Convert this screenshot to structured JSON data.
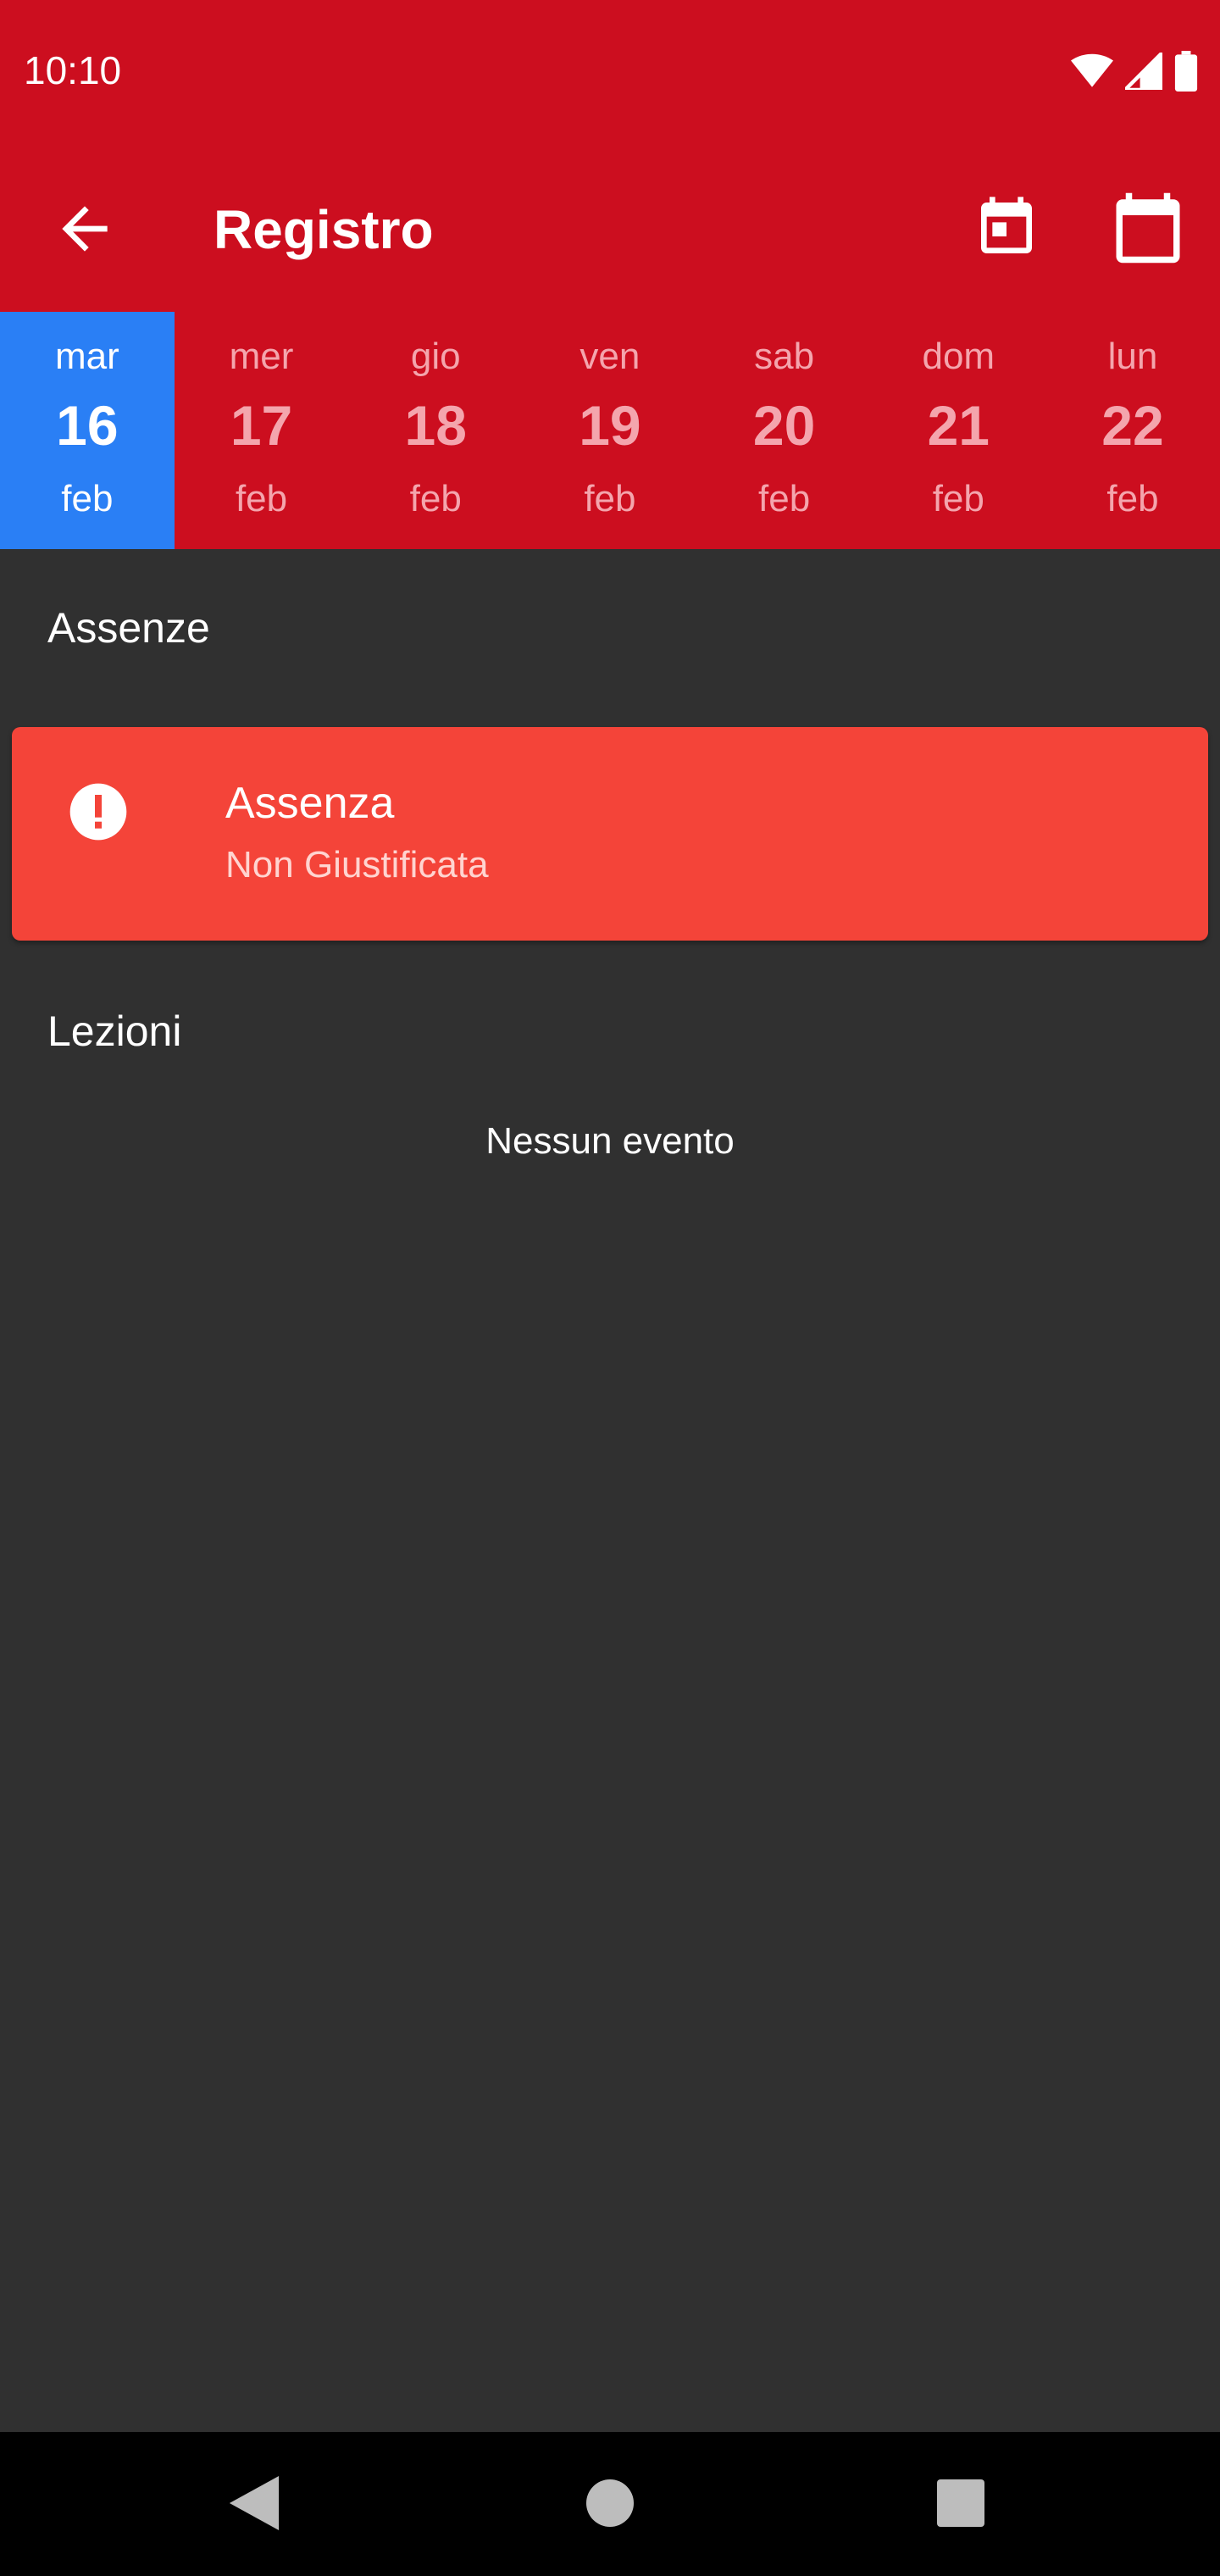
{
  "status_bar": {
    "time": "10:10",
    "icons": [
      "wifi-icon",
      "signal-icon",
      "battery-icon"
    ]
  },
  "app_bar": {
    "title": "Registro",
    "icons": [
      "arrow-back-icon",
      "today-icon",
      "calendar-icon"
    ]
  },
  "days": [
    {
      "dow": "mar",
      "num": "16",
      "mon": "feb",
      "selected": true
    },
    {
      "dow": "mer",
      "num": "17",
      "mon": "feb",
      "selected": false
    },
    {
      "dow": "gio",
      "num": "18",
      "mon": "feb",
      "selected": false
    },
    {
      "dow": "ven",
      "num": "19",
      "mon": "feb",
      "selected": false
    },
    {
      "dow": "sab",
      "num": "20",
      "mon": "feb",
      "selected": false
    },
    {
      "dow": "dom",
      "num": "21",
      "mon": "feb",
      "selected": false
    },
    {
      "dow": "lun",
      "num": "22",
      "mon": "feb",
      "selected": false
    }
  ],
  "absences": {
    "title": "Assenze",
    "items": [
      {
        "title": "Assenza",
        "subtitle": "Non Giustificata",
        "icon": "alert-icon"
      }
    ]
  },
  "lessons": {
    "title": "Lezioni",
    "empty_text": "Nessun evento"
  },
  "colors": {
    "primary": "#cc0e1f",
    "selected_day": "#2a7ff5",
    "absence_card": "#f44439",
    "background": "#303030"
  }
}
